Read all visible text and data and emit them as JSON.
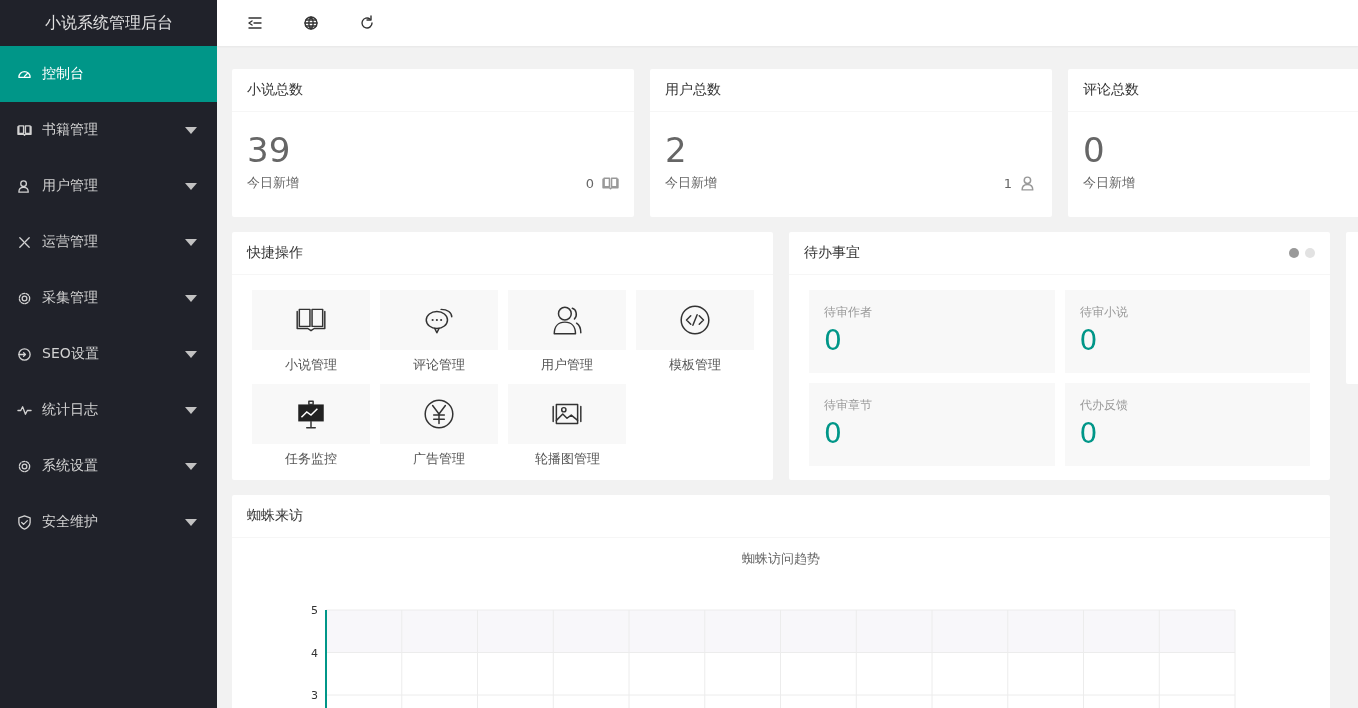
{
  "sidebar": {
    "title": "小说系统管理后台",
    "items": [
      {
        "label": "控制台",
        "selected": true,
        "expandable": false
      },
      {
        "label": "书籍管理",
        "selected": false,
        "expandable": true
      },
      {
        "label": "用户管理",
        "selected": false,
        "expandable": true
      },
      {
        "label": "运营管理",
        "selected": false,
        "expandable": true
      },
      {
        "label": "采集管理",
        "selected": false,
        "expandable": true
      },
      {
        "label": "SEO设置",
        "selected": false,
        "expandable": true
      },
      {
        "label": "统计日志",
        "selected": false,
        "expandable": true
      },
      {
        "label": "系统设置",
        "selected": false,
        "expandable": true
      },
      {
        "label": "安全维护",
        "selected": false,
        "expandable": true
      }
    ]
  },
  "stats": [
    {
      "title": "小说总数",
      "value": "39",
      "sub_label": "今日新增",
      "today": "0"
    },
    {
      "title": "用户总数",
      "value": "2",
      "sub_label": "今日新增",
      "today": "1"
    },
    {
      "title": "评论总数",
      "value": "0",
      "sub_label": "今日新增"
    }
  ],
  "quick_actions": {
    "title": "快捷操作",
    "items": [
      {
        "label": "小说管理"
      },
      {
        "label": "评论管理"
      },
      {
        "label": "用户管理"
      },
      {
        "label": "模板管理"
      },
      {
        "label": "任务监控"
      },
      {
        "label": "广告管理"
      },
      {
        "label": "轮播图管理"
      }
    ]
  },
  "todo": {
    "title": "待办事宜",
    "pages": [
      {
        "selected": true
      },
      {
        "selected": false
      }
    ],
    "items": [
      {
        "label": "待审作者",
        "value": "0"
      },
      {
        "label": "待审小说",
        "value": "0"
      },
      {
        "label": "待审章节",
        "value": "0"
      },
      {
        "label": "代办反馈",
        "value": "0"
      }
    ]
  },
  "spider": {
    "title": "蜘蛛来访",
    "chart_title": "蜘蛛访问趋势",
    "axis_labels": [
      "5",
      "4",
      "3"
    ]
  }
}
